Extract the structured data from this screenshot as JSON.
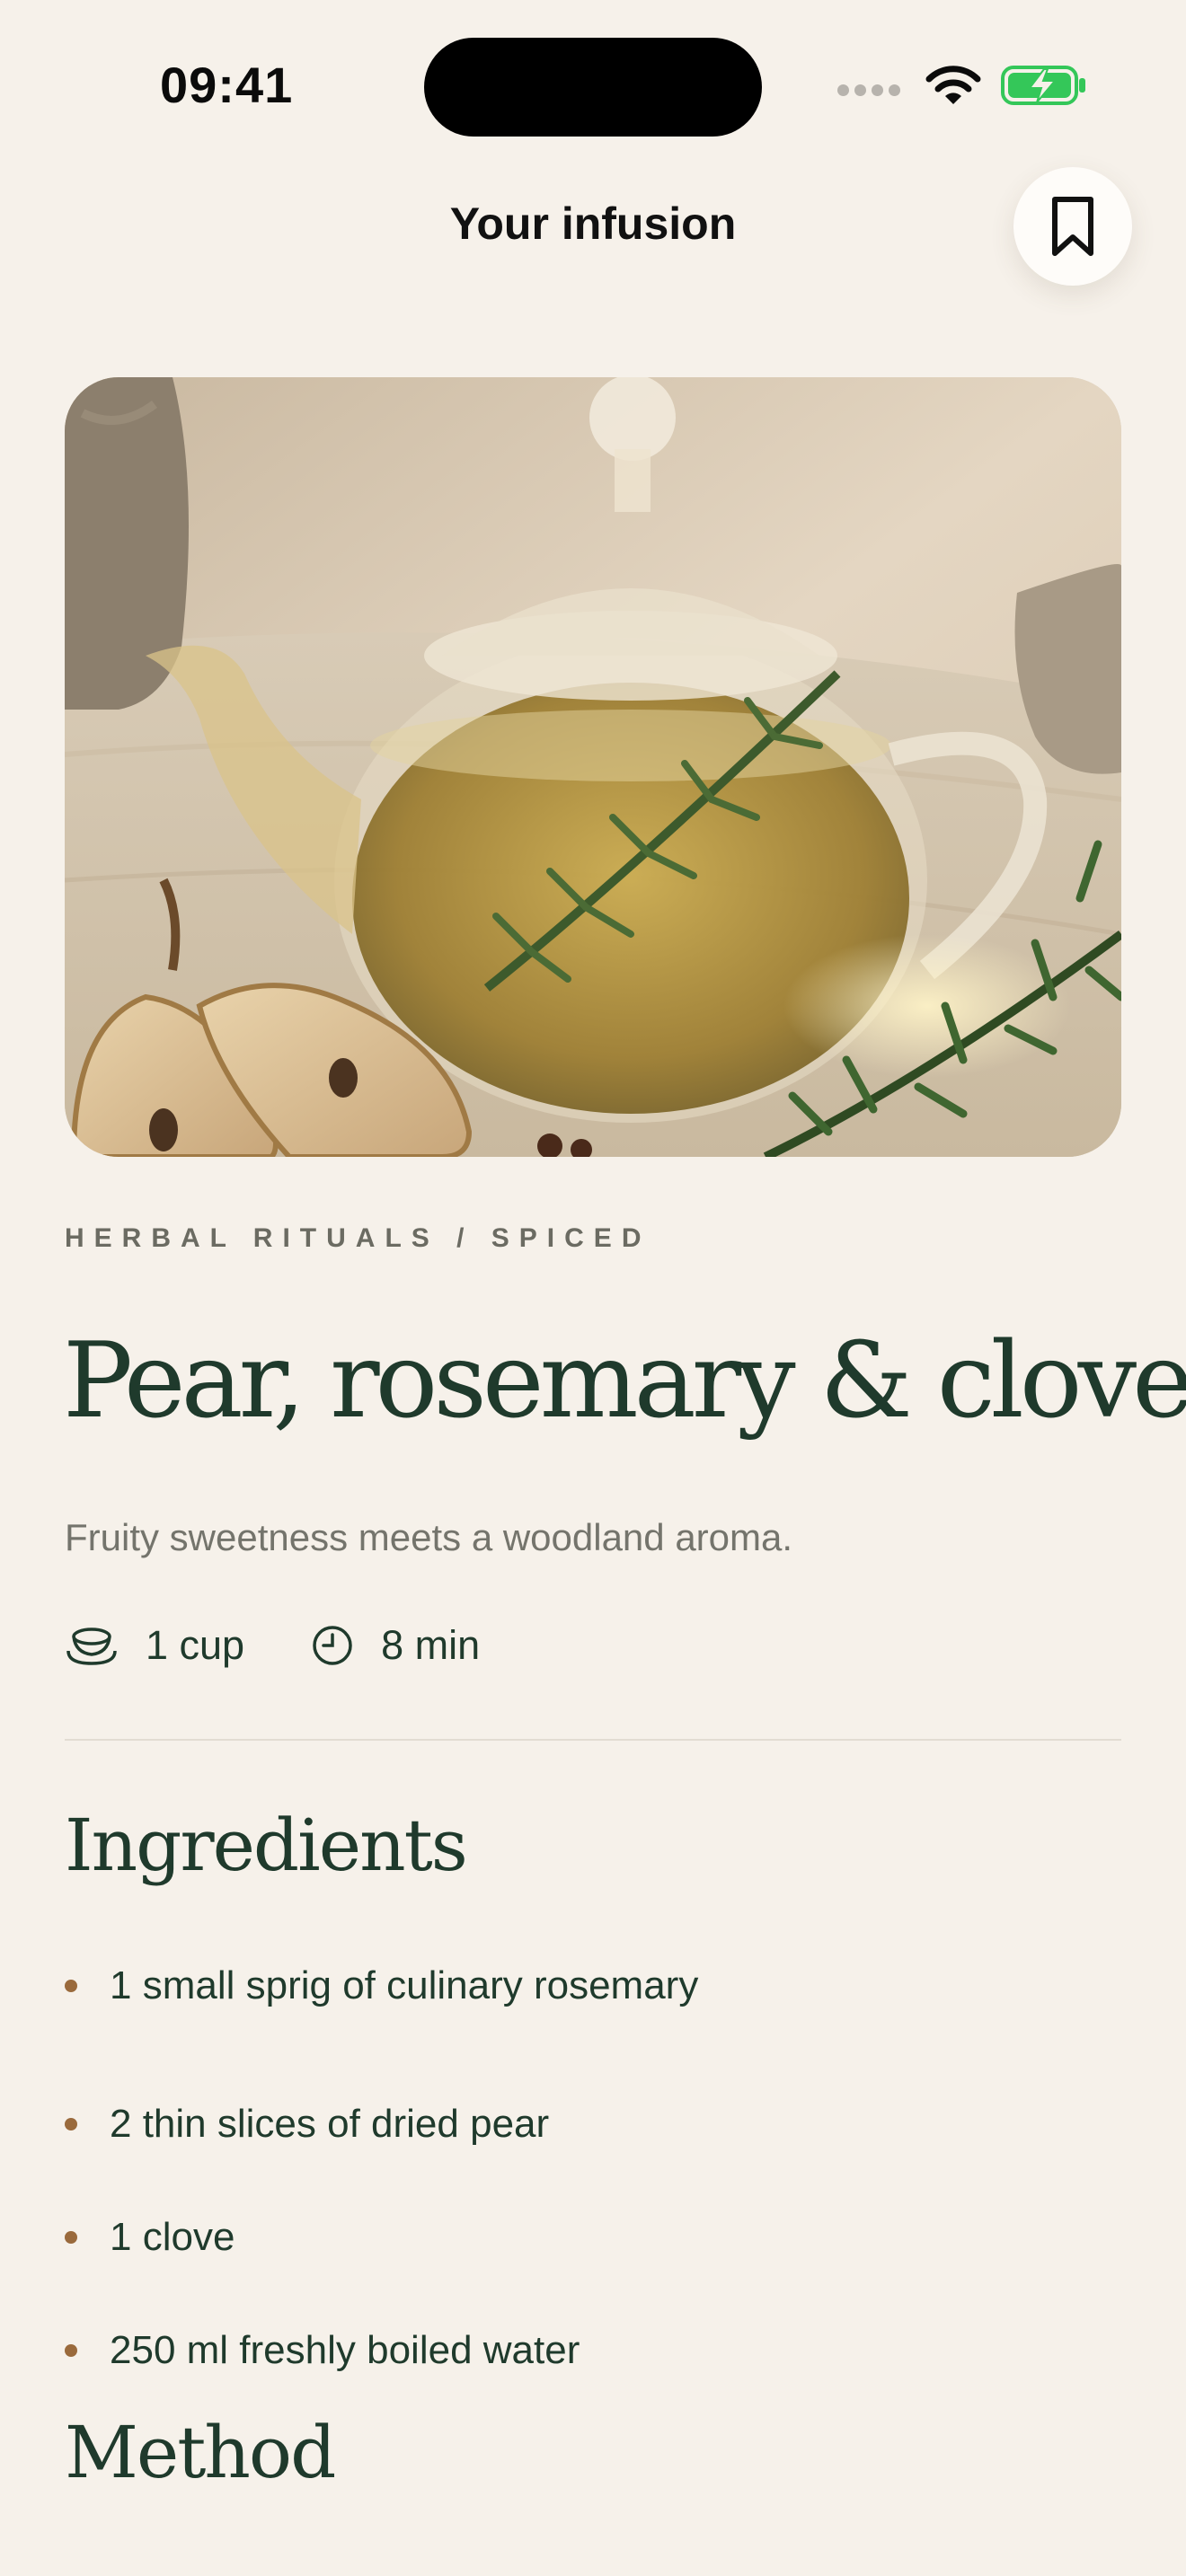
{
  "status_bar": {
    "time": "09:41",
    "icons": [
      "cellular-signal-icon",
      "wifi-icon",
      "battery-charging-icon"
    ]
  },
  "header": {
    "title": "Your infusion",
    "bookmark_icon": "bookmark-icon"
  },
  "hero_image": {
    "alt": "Glass teapot of herbal infusion with rosemary sprig, dried pear slices and cloves"
  },
  "recipe": {
    "category": "HERBAL RITUALS / SPICED",
    "title": "Pear, rosemary & clove",
    "subtitle": "Fruity sweetness meets a woodland aroma.",
    "servings": "1 cup",
    "time": "8 min"
  },
  "ingredients": {
    "heading": "Ingredients",
    "items": [
      "1 small sprig of culinary rosemary",
      "2 thin slices of dried pear",
      "1 clove",
      "250 ml freshly boiled water"
    ]
  },
  "method": {
    "heading": "Method"
  },
  "colors": {
    "background": "#f6f1ea",
    "heading_green": "#1f3a2c",
    "bullet_brown": "#9a6a3c",
    "battery_green": "#34c759"
  }
}
